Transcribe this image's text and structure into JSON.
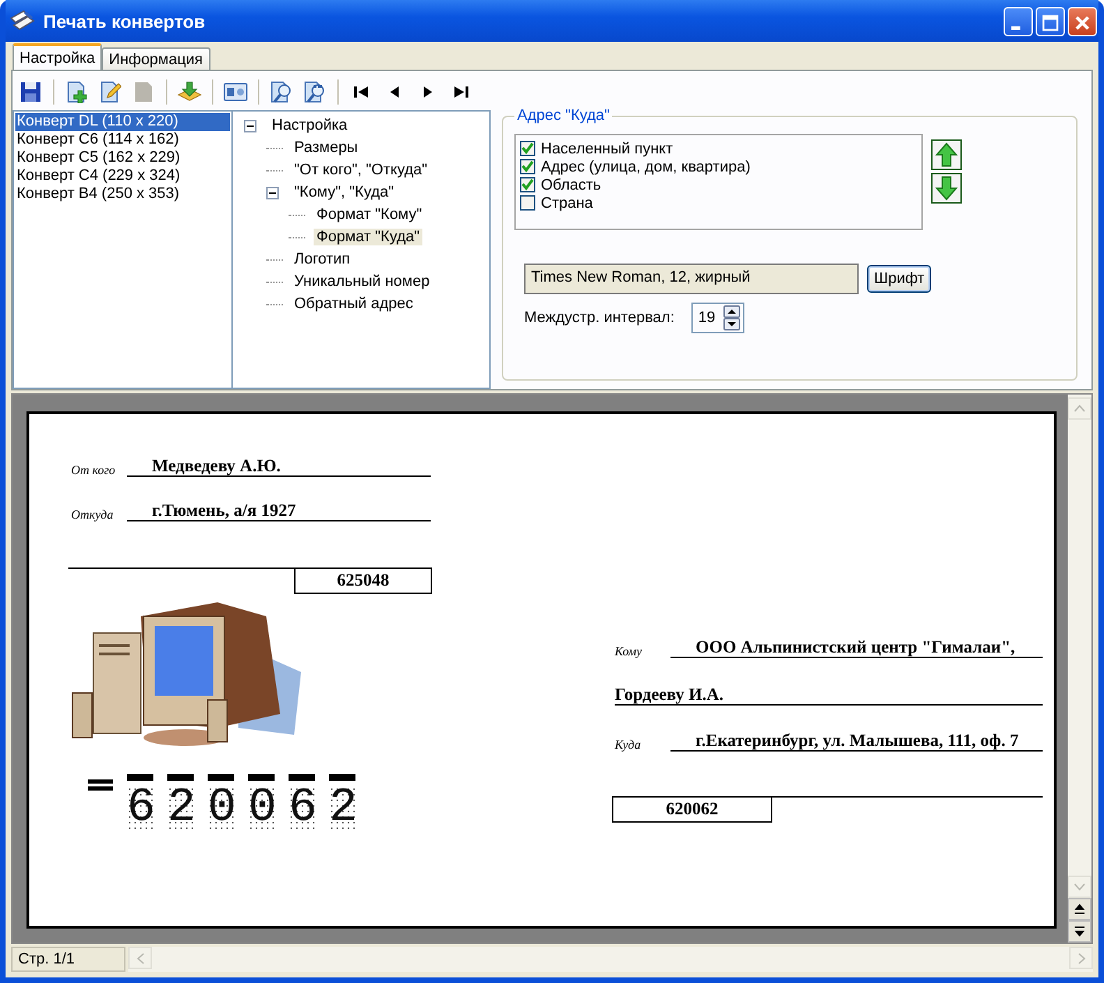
{
  "window": {
    "title": "Печать конвертов"
  },
  "tabs": [
    {
      "label": "Настройка",
      "selected": true
    },
    {
      "label": "Информация",
      "selected": false
    }
  ],
  "toolbar": [
    {
      "kind": "save",
      "disabled": false
    },
    {
      "kind": "sep"
    },
    {
      "kind": "add",
      "disabled": false
    },
    {
      "kind": "edit",
      "disabled": false
    },
    {
      "kind": "delete",
      "disabled": true
    },
    {
      "kind": "sep"
    },
    {
      "kind": "import",
      "disabled": false
    },
    {
      "kind": "sep"
    },
    {
      "kind": "card",
      "disabled": false
    },
    {
      "kind": "sep"
    },
    {
      "kind": "zoom",
      "disabled": false
    },
    {
      "kind": "zoom10",
      "disabled": false
    },
    {
      "kind": "sep"
    },
    {
      "kind": "first",
      "disabled": false
    },
    {
      "kind": "prev",
      "disabled": false
    },
    {
      "kind": "next",
      "disabled": false
    },
    {
      "kind": "last",
      "disabled": false
    }
  ],
  "envelopes": [
    {
      "label": "Конверт DL (110 x 220)",
      "selected": true
    },
    {
      "label": "Конверт C6 (114 x 162)",
      "selected": false
    },
    {
      "label": "Конверт C5 (162 x 229)",
      "selected": false
    },
    {
      "label": "Конверт C4 (229 x 324)",
      "selected": false
    },
    {
      "label": "Конверт B4 (250 x 353)",
      "selected": false
    }
  ],
  "tree": [
    {
      "label": "Настройка",
      "expanded": true,
      "selected": false,
      "children": [
        {
          "label": "Размеры",
          "selected": false
        },
        {
          "label": "\"От кого\", \"Откуда\"",
          "selected": false
        },
        {
          "label": "\"Кому\", \"Куда\"",
          "expanded": true,
          "selected": false,
          "children": [
            {
              "label": "Формат \"Кому\"",
              "selected": false
            },
            {
              "label": "Формат \"Куда\"",
              "selected": true
            }
          ]
        },
        {
          "label": "Логотип",
          "selected": false
        },
        {
          "label": "Уникальный номер",
          "selected": false
        },
        {
          "label": "Обратный адрес",
          "selected": false
        }
      ]
    }
  ],
  "address_group": {
    "title": "Адрес \"Куда\"",
    "fields": [
      {
        "label": "Населенный пункт",
        "checked": true
      },
      {
        "label": "Адрес (улица, дом, квартира)",
        "checked": true
      },
      {
        "label": "Область",
        "checked": true
      },
      {
        "label": "Страна",
        "checked": false
      }
    ],
    "font_value": "Times New Roman, 12, жирный",
    "font_button": "Шрифт",
    "spacing_label": "Междустр. интервал:",
    "spacing_value": "19"
  },
  "envelope": {
    "from_label": "От кого",
    "from_value": "Медведеву А.Ю.",
    "whence_label": "Откуда",
    "whence_value": "г.Тюмень, а/я 1927",
    "sender_index": "625048",
    "to_label": "Кому",
    "to_line_1": "ООО Альпинистский центр \"Гималаи\",",
    "to_line_2": "Гордееву И.А.",
    "where_label": "Куда",
    "where_value": "г.Екатеринбург, ул. Малышева, 111, оф. 7",
    "recipient_index": "620062",
    "postcode_digits": [
      "6",
      "2",
      "0",
      "0",
      "6",
      "2"
    ]
  },
  "status_bar": {
    "page": "Стр. 1/1"
  }
}
